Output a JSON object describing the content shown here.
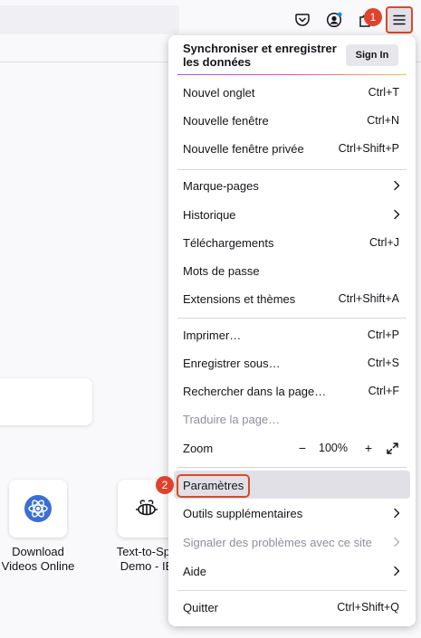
{
  "menu": {
    "header": {
      "title": "Synchroniser et enregistrer les données",
      "sign_in": "Sign In"
    },
    "items": [
      {
        "label": "Nouvel onglet",
        "shortcut": "Ctrl+T"
      },
      {
        "label": "Nouvelle fenêtre",
        "shortcut": "Ctrl+N"
      },
      {
        "label": "Nouvelle fenêtre privée",
        "shortcut": "Ctrl+Shift+P"
      },
      {
        "label": "Marque-pages",
        "submenu": true
      },
      {
        "label": "Historique",
        "submenu": true
      },
      {
        "label": "Téléchargements",
        "shortcut": "Ctrl+J"
      },
      {
        "label": "Mots de passe"
      },
      {
        "label": "Extensions et thèmes",
        "shortcut": "Ctrl+Shift+A"
      },
      {
        "label": "Imprimer…",
        "shortcut": "Ctrl+P"
      },
      {
        "label": "Enregistrer sous…",
        "shortcut": "Ctrl+S"
      },
      {
        "label": "Rechercher dans la page…",
        "shortcut": "Ctrl+F"
      },
      {
        "label": "Traduire la page…",
        "disabled": true
      },
      {
        "label": "Zoom",
        "zoom_minus": "−",
        "zoom_value": "100%",
        "zoom_plus": "+"
      },
      {
        "label": "Paramètres",
        "highlighted": true
      },
      {
        "label": "Outils supplémentaires",
        "submenu": true
      },
      {
        "label": "Signaler des problèmes avec ce site",
        "submenu": true,
        "disabled": true
      },
      {
        "label": "Aide",
        "submenu": true
      },
      {
        "label": "Quitter",
        "shortcut": "Ctrl+Shift+Q"
      }
    ]
  },
  "markers": {
    "first": "1",
    "second": "2"
  },
  "shortcuts": [
    {
      "label_line1": "Download",
      "label_line2": "Videos Online",
      "icon": "atom-icon"
    },
    {
      "label_line1": "Text-to-Spe",
      "label_line2": "Demo - IB",
      "icon": "bee-icon"
    }
  ],
  "colors": {
    "accent_highlight": "#d9492b",
    "marker": "#e0422c",
    "hover_bg": "#e0e0e6",
    "disabled_text": "#8f8f9d"
  }
}
